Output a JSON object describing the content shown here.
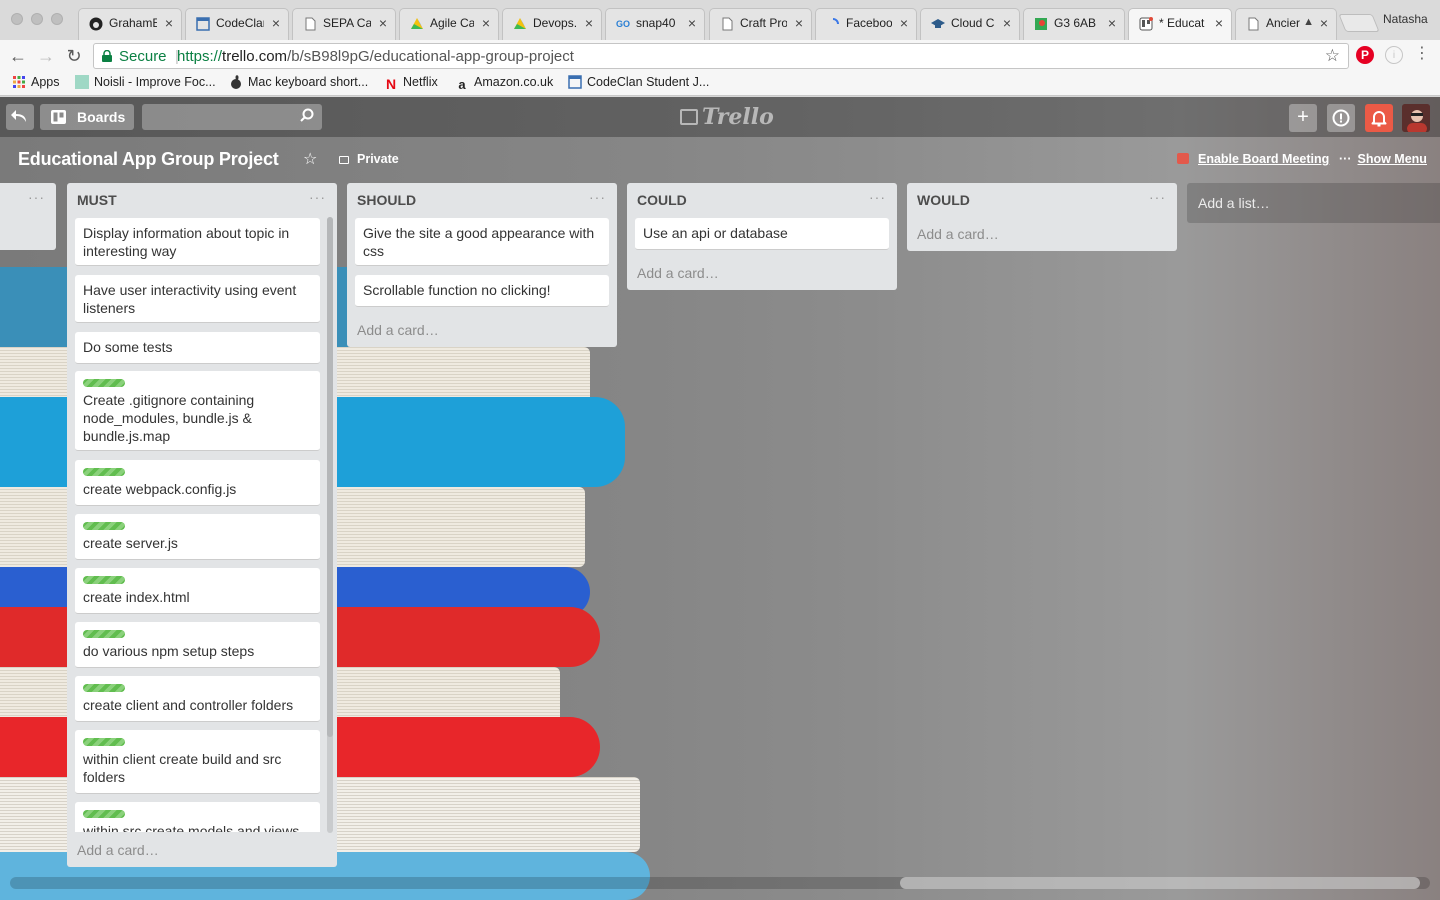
{
  "browser": {
    "tabs": [
      {
        "label": "GrahamE",
        "icon": "github-icon"
      },
      {
        "label": "CodeClar",
        "icon": "page-icon"
      },
      {
        "label": "SEPA Ca",
        "icon": "page-icon"
      },
      {
        "label": "Agile Ca",
        "icon": "drive-icon"
      },
      {
        "label": "Devops.",
        "icon": "drive-icon"
      },
      {
        "label": "snap40",
        "icon": "snap-icon"
      },
      {
        "label": "Craft Pro",
        "icon": "page-icon"
      },
      {
        "label": "Faceboo",
        "icon": "loading-icon"
      },
      {
        "label": "Cloud C",
        "icon": "cap-icon"
      },
      {
        "label": "G3 6AB",
        "icon": "maps-icon"
      },
      {
        "label": "* Educat",
        "icon": "trello-icon"
      },
      {
        "label": "Ancier",
        "icon": "page-icon"
      }
    ],
    "profile": "Natasha",
    "omnibox": {
      "secure_label": "Secure",
      "url_scheme": "https://",
      "url_host": "trello.com",
      "url_path": "/b/sB98l9pG/educational-app-group-project"
    },
    "bookmarks": [
      {
        "label": "Apps",
        "icon": "apps-grid-icon"
      },
      {
        "label": "Noisli - Improve Foc...",
        "icon": "noisli-icon"
      },
      {
        "label": "Mac keyboard short...",
        "icon": "apple-icon"
      },
      {
        "label": "Netflix",
        "icon": "netflix-icon"
      },
      {
        "label": "Amazon.co.uk",
        "icon": "amazon-icon"
      },
      {
        "label": "CodeClan Student J...",
        "icon": "page-icon"
      }
    ]
  },
  "trello": {
    "boards_label": "Boards",
    "logo_text": "Trello",
    "board_title": "Educational App Group Project",
    "privacy_label": "Private",
    "meeting_label": "Enable Board Meeting",
    "menu_label": "Show Menu",
    "add_list_label": "Add a list…",
    "add_card_label": "Add a card…",
    "list_menu_glyph": "···",
    "lists": [
      {
        "title": "MUST",
        "cards": [
          {
            "text": "Display information about topic in interesting way",
            "label": false
          },
          {
            "text": "Have user interactivity using event listeners",
            "label": false
          },
          {
            "text": "Do some tests",
            "label": false
          },
          {
            "text": "Create .gitignore containing node_modules, bundle.js & bundle.js.map",
            "label": true
          },
          {
            "text": "create webpack.config.js",
            "label": true
          },
          {
            "text": "create server.js",
            "label": true
          },
          {
            "text": "create index.html",
            "label": true
          },
          {
            "text": "do various npm setup steps",
            "label": true
          },
          {
            "text": "create client and controller folders",
            "label": true
          },
          {
            "text": "within client create build and src folders",
            "label": true
          },
          {
            "text": "within src create models and views",
            "label": true
          }
        ]
      },
      {
        "title": "SHOULD",
        "cards": [
          {
            "text": "Give the site a good appearance with css",
            "label": false
          },
          {
            "text": "Scrollable function no clicking!",
            "label": false
          }
        ]
      },
      {
        "title": "COULD",
        "cards": [
          {
            "text": "Use an api or database",
            "label": false
          }
        ]
      },
      {
        "title": "WOULD",
        "cards": []
      }
    ],
    "label_color": "#61bd4f"
  }
}
